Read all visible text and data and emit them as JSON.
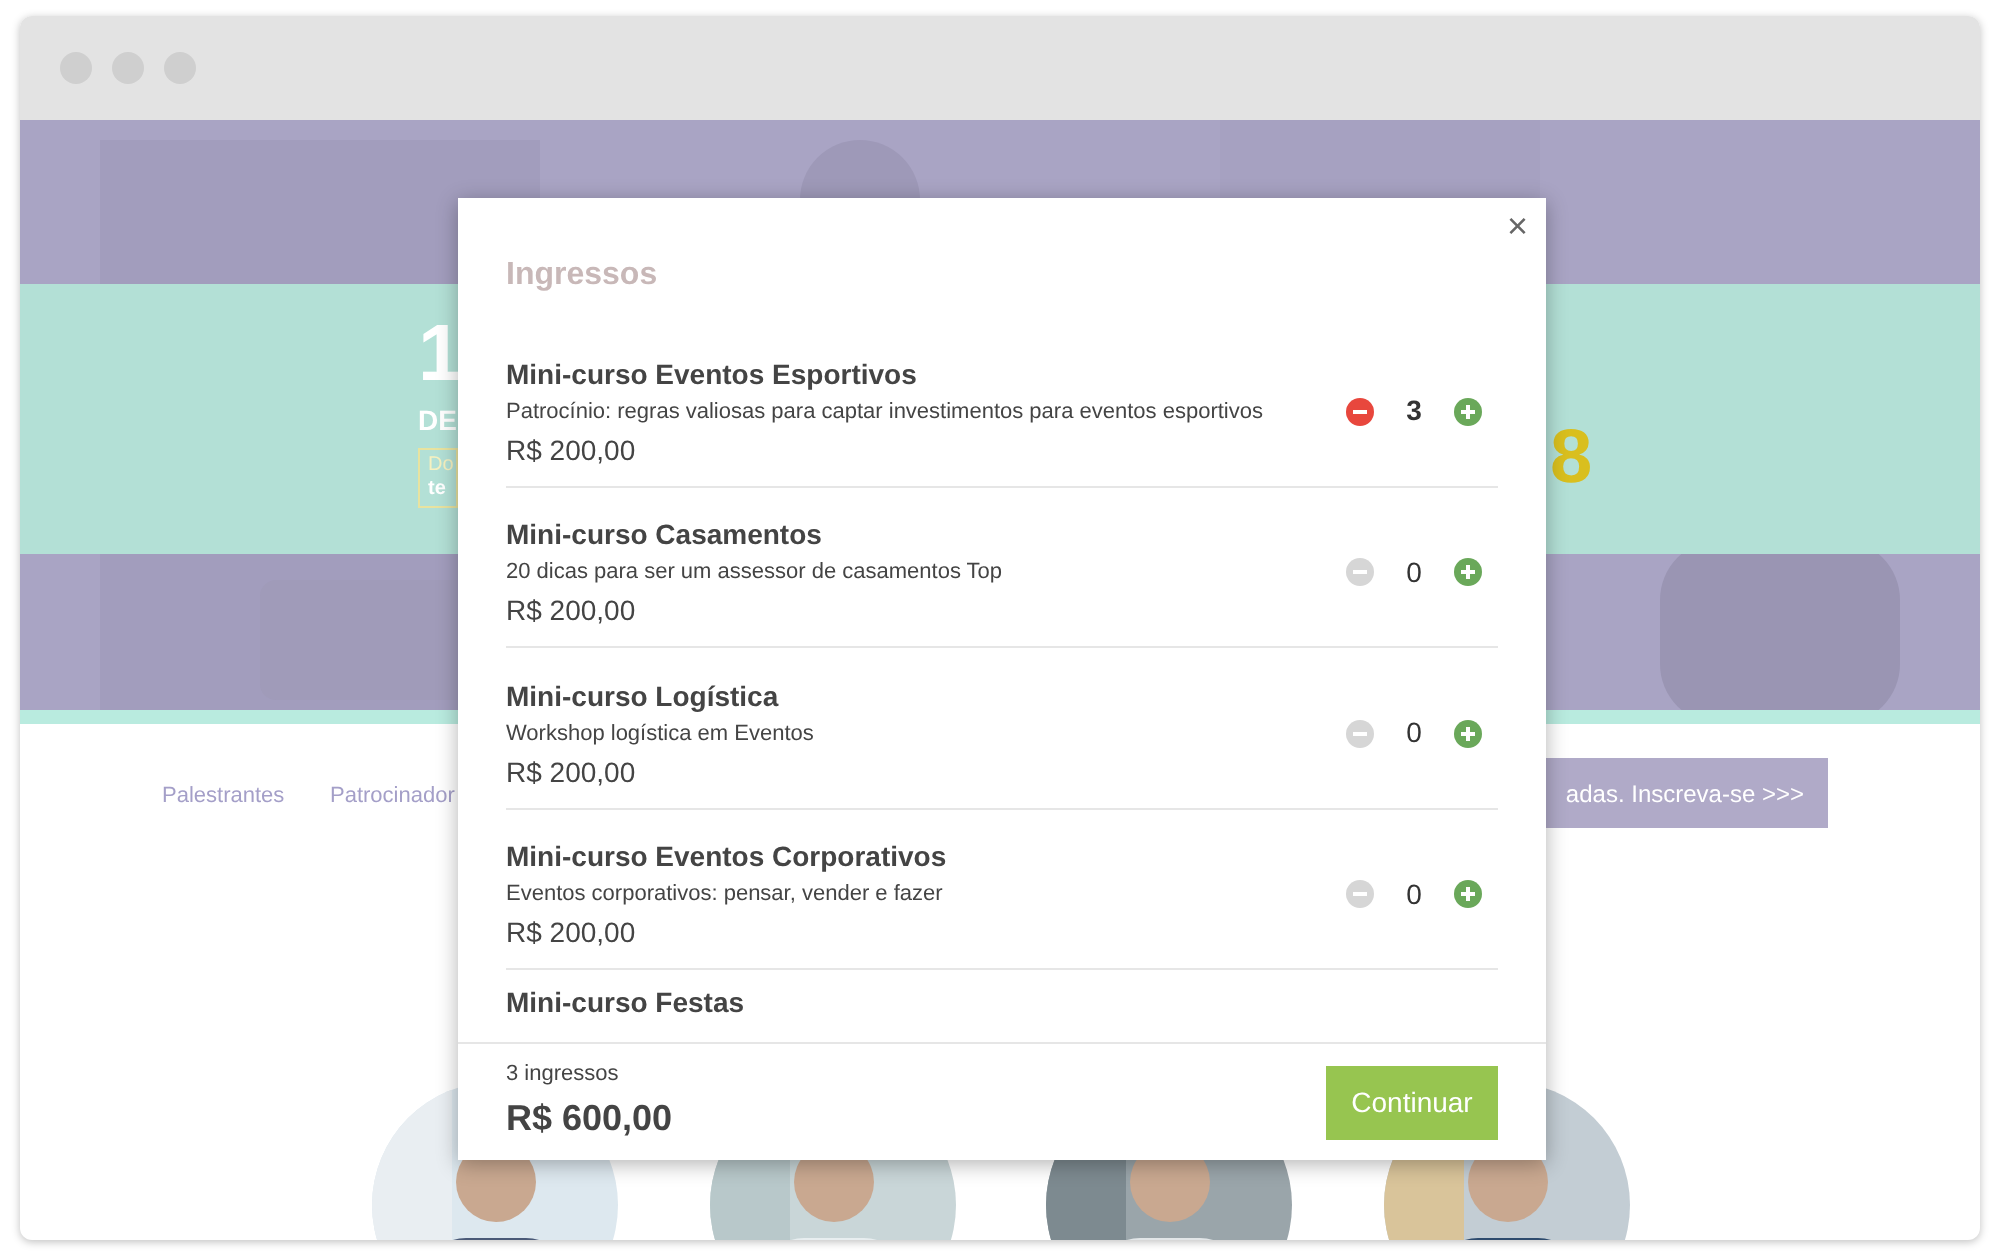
{
  "hero": {
    "fragments": [
      {
        "kind": "big",
        "text": "1"
      },
      {
        "kind": "sub",
        "text": "DE"
      },
      {
        "kind": "boxed",
        "text": "Do"
      },
      {
        "kind": "boxed_bold",
        "text": "te"
      },
      {
        "kind": "year",
        "text": "8"
      }
    ]
  },
  "nav": {
    "links": [
      "Palestrantes",
      "Patrocinador"
    ],
    "cta": "adas. Inscreva-se >>>"
  },
  "modal": {
    "title": "Ingressos",
    "close": "×",
    "items": [
      {
        "name": "Mini-curso Eventos Esportivos",
        "description": "Patrocínio: regras valiosas para captar investimentos para eventos esportivos",
        "price": "R$ 200,00",
        "quantity": "3",
        "minus_disabled": false
      },
      {
        "name": "Mini-curso Casamentos",
        "description": "20 dicas para ser um assessor de casamentos Top",
        "price": "R$ 200,00",
        "quantity": "0",
        "minus_disabled": true
      },
      {
        "name": "Mini-curso Logística",
        "description": "Workshop logística em Eventos",
        "price": "R$ 200,00",
        "quantity": "0",
        "minus_disabled": true
      },
      {
        "name": "Mini-curso Eventos Corporativos",
        "description": "Eventos corporativos: pensar, vender e fazer",
        "price": "R$ 200,00",
        "quantity": "0",
        "minus_disabled": true
      },
      {
        "name": "Mini-curso Festas"
      }
    ],
    "footer": {
      "count": "3 ingressos",
      "total": "R$ 600,00",
      "button": "Continuar"
    }
  }
}
